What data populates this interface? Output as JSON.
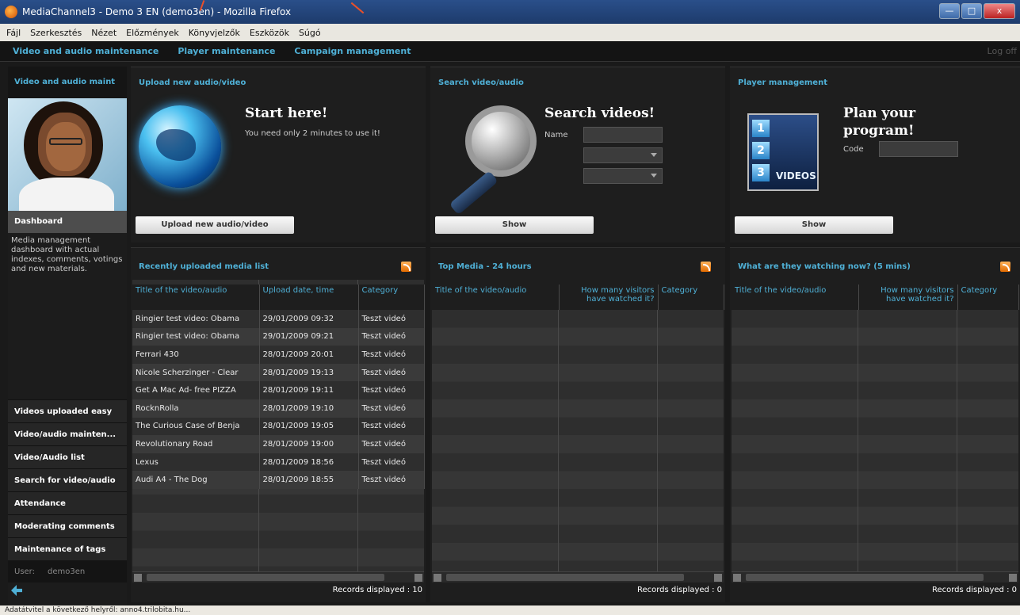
{
  "window": {
    "title": "MediaChannel3 - Demo 3 EN (demo3en) - Mozilla Firefox",
    "min": "—",
    "max": "□",
    "close": "x"
  },
  "menu": [
    "Fájl",
    "Szerkesztés",
    "Nézet",
    "Előzmények",
    "Könyvjelzők",
    "Eszközök",
    "Súgó"
  ],
  "appnav": {
    "items": [
      "Video and audio maintenance",
      "Player maintenance",
      "Campaign management"
    ],
    "logoff": "Log off"
  },
  "sidebar": {
    "header": "Video and audio maint",
    "dashboard": "Dashboard",
    "description": "Media management dashboard with actual indexes, comments, votings and new materials.",
    "items": [
      "Videos uploaded easy",
      "Video/audio mainten...",
      "Video/Audio list",
      "Search for video/audio",
      "Attendance",
      "Moderating comments",
      "Maintenance of tags"
    ],
    "user_label": "User:",
    "user_value": "demo3en"
  },
  "upload": {
    "title": "Upload new audio/video",
    "headline": "Start here!",
    "sub": "You need only 2 minutes to use it!",
    "button": "Upload new audio/video"
  },
  "search": {
    "title": "Search video/audio",
    "headline": "Search videos!",
    "name_label": "Name",
    "button": "Show"
  },
  "player": {
    "title": "Player management",
    "headline_1": "Plan your",
    "headline_2": "program!",
    "code_label": "Code",
    "clip_numbers": [
      "1",
      "2",
      "3"
    ],
    "clip_word": "VIDEOS",
    "button": "Show"
  },
  "recent": {
    "title": "Recently uploaded media list",
    "columns": [
      "Title of the video/audio",
      "Upload date, time",
      "Category"
    ],
    "rows": [
      [
        "Ringier test video: Obama",
        "29/01/2009 09:32",
        "Teszt videó"
      ],
      [
        "Ringier test video: Obama",
        "29/01/2009 09:21",
        "Teszt videó"
      ],
      [
        "Ferrari 430",
        "28/01/2009 20:01",
        "Teszt videó"
      ],
      [
        "Nicole Scherzinger - Clear",
        "28/01/2009 19:13",
        "Teszt videó"
      ],
      [
        "Get A Mac Ad- free PIZZA",
        "28/01/2009 19:11",
        "Teszt videó"
      ],
      [
        "RocknRolla",
        "28/01/2009 19:10",
        "Teszt videó"
      ],
      [
        "The Curious Case of Benja",
        "28/01/2009 19:05",
        "Teszt videó"
      ],
      [
        "Revolutionary Road",
        "28/01/2009 19:00",
        "Teszt videó"
      ],
      [
        "Lexus",
        "28/01/2009 18:56",
        "Teszt videó"
      ],
      [
        "Audi A4 - The Dog",
        "28/01/2009 18:55",
        "Teszt videó"
      ]
    ],
    "records": "Records displayed : 10"
  },
  "topmedia": {
    "title": "Top Media - 24 hours",
    "columns": [
      "Title of the video/audio",
      "How many visitors have watched it?",
      "Category"
    ],
    "records": "Records displayed : 0"
  },
  "watching": {
    "title": "What are they watching now? (5 mins)",
    "columns": [
      "Title of the video/audio",
      "How many visitors have watched it?",
      "Category"
    ],
    "records": "Records displayed : 0"
  },
  "status": "Adatátvitel a következő helyről: anno4.trilobita.hu..."
}
